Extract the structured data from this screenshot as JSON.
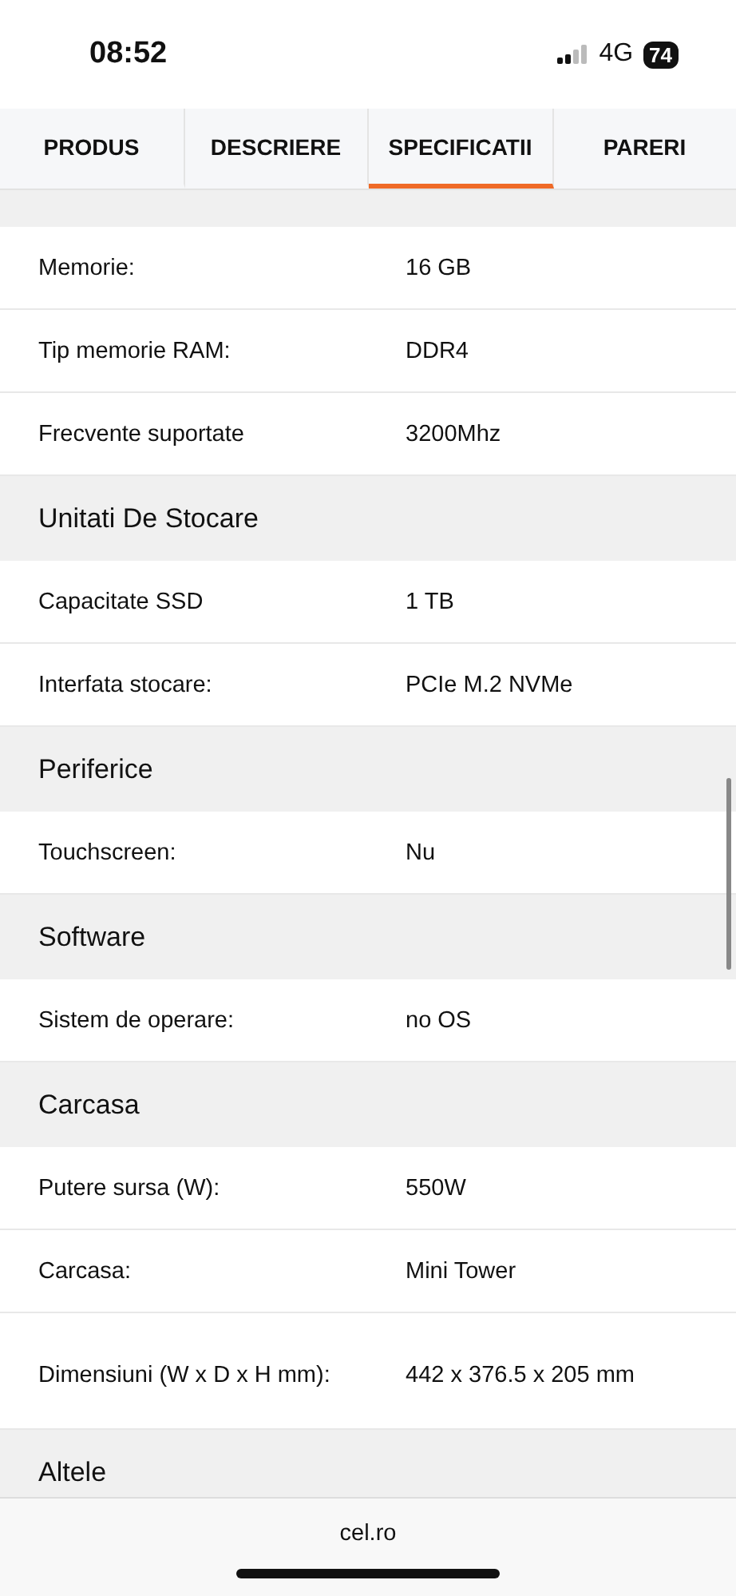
{
  "status_bar": {
    "time": "08:52",
    "network": "4G",
    "battery": "74"
  },
  "tabs": [
    {
      "label": "PRODUS",
      "selected": false
    },
    {
      "label": "DESCRIERE",
      "selected": false
    },
    {
      "label": "SPECIFICATII",
      "selected": true
    },
    {
      "label": "PARERI",
      "selected": false
    }
  ],
  "items": [
    {
      "kind": "row",
      "label": "Memorie:",
      "value": "16 GB"
    },
    {
      "kind": "row",
      "label": "Tip memorie RAM:",
      "value": "DDR4"
    },
    {
      "kind": "row",
      "label": "Frecvente suportate",
      "value": "3200Mhz"
    },
    {
      "kind": "header",
      "title": "Unitati De Stocare"
    },
    {
      "kind": "row",
      "label": "Capacitate SSD",
      "value": "1 TB"
    },
    {
      "kind": "row",
      "label": "Interfata stocare:",
      "value": "PCIe M.2 NVMe"
    },
    {
      "kind": "header",
      "title": "Periferice"
    },
    {
      "kind": "row",
      "label": "Touchscreen:",
      "value": "Nu"
    },
    {
      "kind": "header",
      "title": "Software"
    },
    {
      "kind": "row",
      "label": "Sistem de operare:",
      "value": "no OS"
    },
    {
      "kind": "header",
      "title": "Carcasa"
    },
    {
      "kind": "row",
      "label": "Putere sursa (W):",
      "value": "550W"
    },
    {
      "kind": "row",
      "label": "Carcasa:",
      "value": "Mini Tower"
    },
    {
      "kind": "row",
      "label": "Dimensiuni (W x D x H mm):",
      "value": "442 x 376.5 x 205 mm"
    },
    {
      "kind": "header",
      "title": "Altele"
    }
  ],
  "address_bar": {
    "domain": "cel.ro"
  }
}
